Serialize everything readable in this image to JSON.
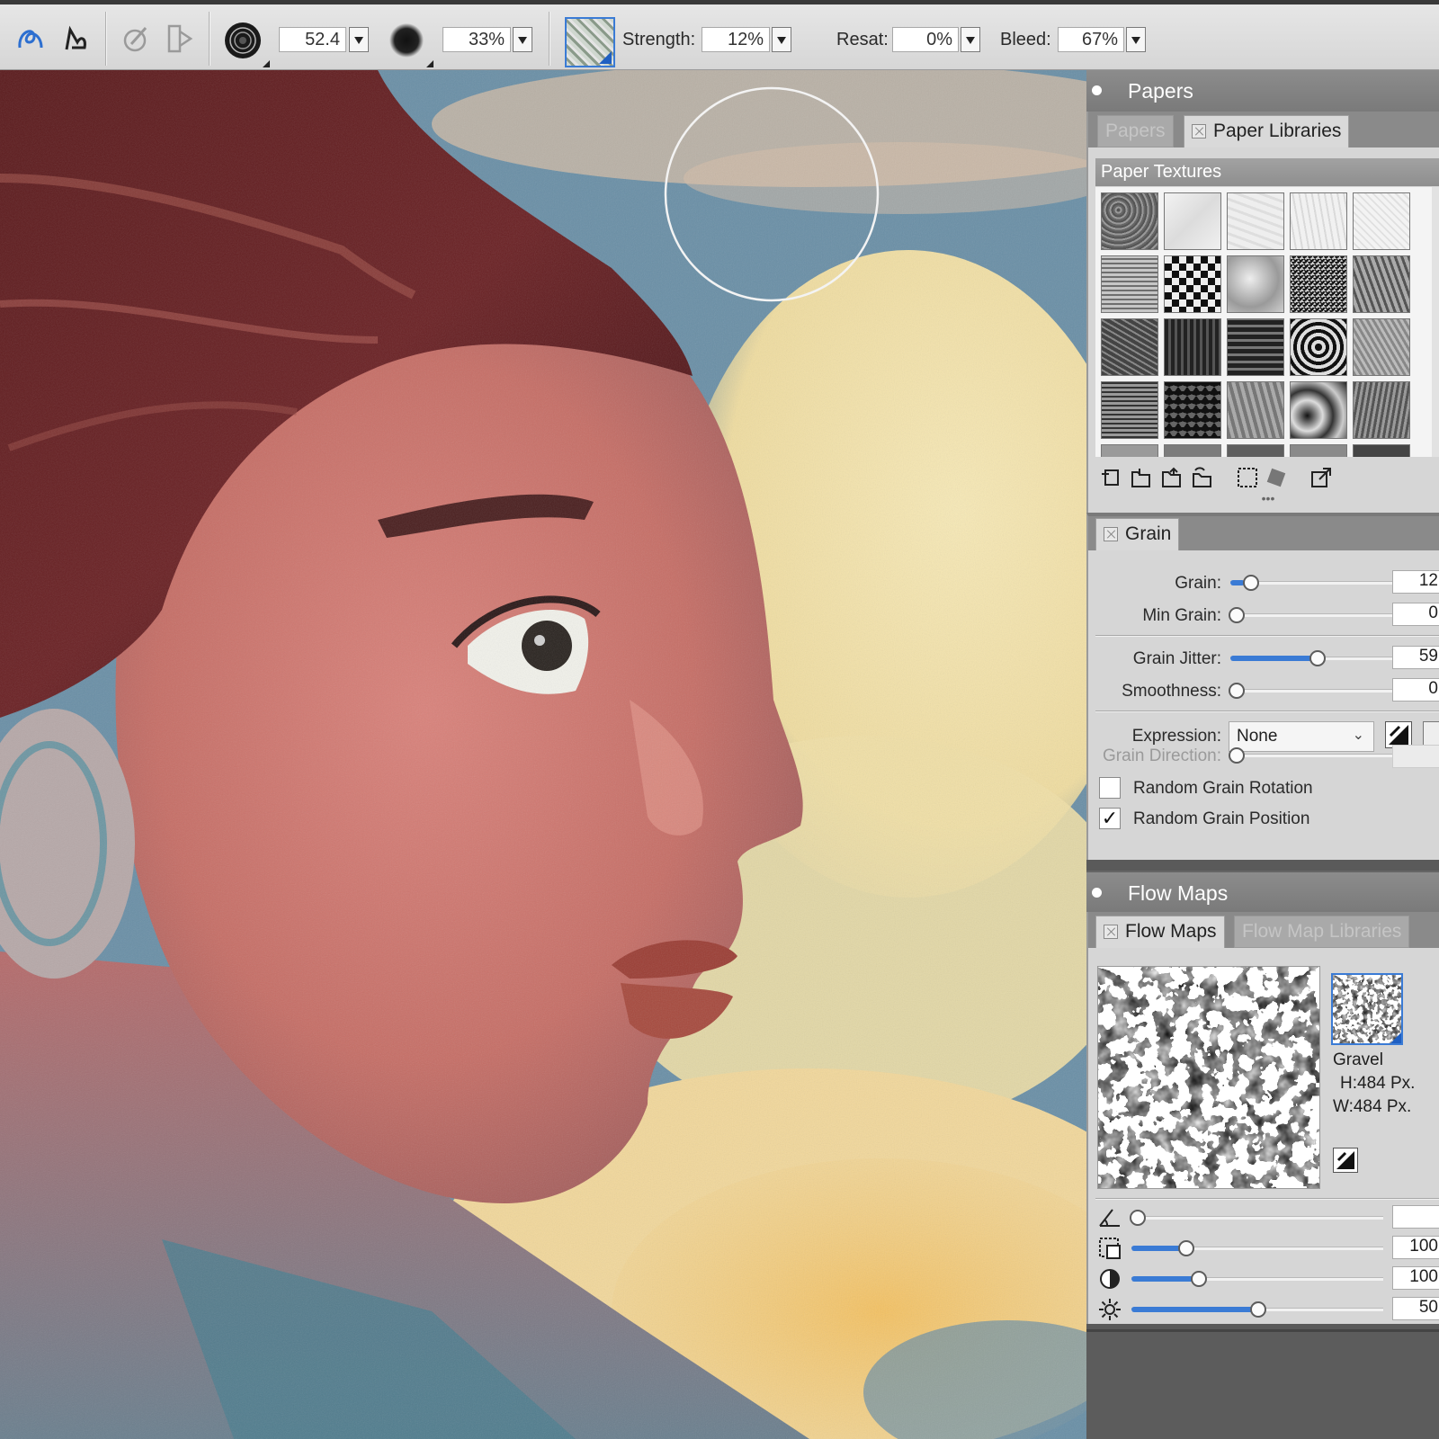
{
  "toolbar": {
    "size_value": "52.4",
    "opacity_value": "33%",
    "strength_label": "Strength:",
    "strength_value": "12%",
    "resat_label": "Resat:",
    "resat_value": "0%",
    "bleed_label": "Bleed:",
    "bleed_value": "67%",
    "icons": [
      "stroke-freehand-icon",
      "stroke-straight-icon",
      "eyedropper-brush-icon",
      "clone-source-icon",
      "brush-size-icon",
      "opacity-dot-icon",
      "paper-texture-swatch-icon"
    ]
  },
  "papers_panel": {
    "title": "Papers",
    "tabs": [
      "Papers",
      "Paper Libraries"
    ],
    "active_tab": "Paper Libraries",
    "section_title": "Paper Textures",
    "toolbar_icons": [
      "new-paper-icon",
      "import-paper-icon",
      "export-paper-icon",
      "restore-paper-icon",
      "capture-selection-icon",
      "make-paper-icon",
      "open-library-icon"
    ]
  },
  "grain_panel": {
    "tab": "Grain",
    "sliders": [
      {
        "label": "Grain:",
        "value": "12",
        "level": 0.07
      },
      {
        "label": "Min Grain:",
        "value": "0",
        "level": 0.0
      },
      {
        "label": "Grain Jitter:",
        "value": "59",
        "level": 0.59
      },
      {
        "label": "Smoothness:",
        "value": "0",
        "level": 0.0
      }
    ],
    "expression_label": "Expression:",
    "expression_value": "None",
    "direction_label": "Grain Direction:",
    "direction_level": 0.0,
    "checkboxes": [
      {
        "label": "Random Grain Rotation",
        "checked": false
      },
      {
        "label": "Random Grain Position",
        "checked": true
      }
    ]
  },
  "flowmaps_panel": {
    "title": "Flow Maps",
    "tabs": [
      "Flow Maps",
      "Flow Map Libraries"
    ],
    "active_tab": "Flow Maps",
    "map_name": "Gravel",
    "map_height": "H:484 Px.",
    "map_width": "W:484 Px.",
    "sliders": [
      {
        "icon": "angle-icon",
        "value": "",
        "level": 0.0
      },
      {
        "icon": "scale-icon",
        "value": "100",
        "level": 0.22
      },
      {
        "icon": "contrast-icon",
        "value": "100",
        "level": 0.27
      },
      {
        "icon": "brightness-icon",
        "value": "50",
        "level": 0.5
      }
    ]
  }
}
